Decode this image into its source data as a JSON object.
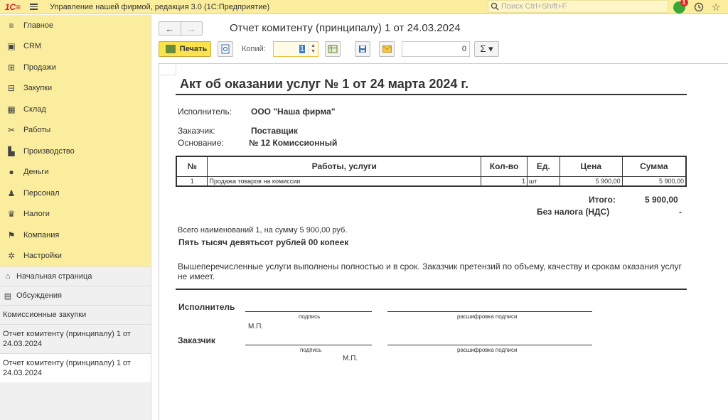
{
  "topbar": {
    "logo": "1С",
    "title": "Управление нашей фирмой, редакция 3.0  (1С:Предприятие)",
    "search_placeholder": "Поиск Ctrl+Shift+F",
    "notifications_count": "1"
  },
  "sidebar": {
    "sections": [
      {
        "label": "Главное",
        "icon": "menu-list-icon",
        "glyph": "≡"
      },
      {
        "label": "CRM",
        "icon": "crm-card-icon",
        "glyph": "▣"
      },
      {
        "label": "Продажи",
        "icon": "sales-basket-icon",
        "glyph": "⊞"
      },
      {
        "label": "Закупки",
        "icon": "purchases-icon",
        "glyph": "⊟"
      },
      {
        "label": "Склад",
        "icon": "warehouse-icon",
        "glyph": "▦"
      },
      {
        "label": "Работы",
        "icon": "tools-icon",
        "glyph": "✂"
      },
      {
        "label": "Производство",
        "icon": "factory-icon",
        "glyph": "▙"
      },
      {
        "label": "Деньги",
        "icon": "money-icon",
        "glyph": "●"
      },
      {
        "label": "Персонал",
        "icon": "staff-icon",
        "glyph": "♟"
      },
      {
        "label": "Налоги",
        "icon": "taxes-icon",
        "glyph": "♛"
      },
      {
        "label": "Компания",
        "icon": "company-flag-icon",
        "glyph": "⚑"
      },
      {
        "label": "Настройки",
        "icon": "settings-gear-icon",
        "glyph": "✲"
      }
    ],
    "nav": [
      {
        "label": "Начальная страница",
        "icon": "home-icon",
        "glyph": "⌂"
      },
      {
        "label": "Обсуждения",
        "icon": "discussion-icon",
        "glyph": "▤"
      }
    ],
    "open_windows": [
      "Комиссионные закупки",
      "Отчет комитенту (принципалу) 1 от 24.03.2024",
      "Отчет комитенту (принципалу) 1 от 24.03.2024"
    ]
  },
  "form": {
    "title": "Отчет комитенту (принципалу) 1 от 24.03.2024",
    "print_label": "Печать",
    "copies_label": "Копий:",
    "copies_value": "1",
    "sum_value": "0",
    "sigma": "Σ ▾"
  },
  "document": {
    "title": "Акт об оказании услуг № 1 от 24 марта 2024 г.",
    "executor_label": "Исполнитель:",
    "executor_value": "ООО \"Наша фирма\"",
    "customer_label": "Заказчик:",
    "customer_value": "Поставщик",
    "basis_label": "Основание:",
    "basis_value": "№ 12 Комиссионный",
    "table": {
      "headers": [
        "№",
        "Работы, услуги",
        "Кол-во",
        "Ед.",
        "Цена",
        "Сумма"
      ],
      "rows": [
        [
          "1",
          "Продажа товаров на комиссии",
          "1",
          "шт",
          "5 900,00",
          "5 900,00"
        ]
      ]
    },
    "total_label": "Итого:",
    "total_value": "5 900,00",
    "vat_label": "Без налога (НДС)",
    "vat_value": "-",
    "summary_line": "Всего наименований 1, на сумму 5 900,00 руб.",
    "amount_words": "Пять тысяч девятьсот рублей 00 копеек",
    "statement": "Вышеперечисленные услуги выполнены полностью и в срок. Заказчик претензий по объему, качеству и срокам оказания услуг не имеет.",
    "sign_executor": "Исполнитель",
    "sign_customer": "Заказчик",
    "caption_signature": "подпись",
    "caption_decoding": "расшифровка подписи",
    "stamp": "М.П."
  },
  "colors": {
    "accent_yellow": "#fbed9e",
    "print_button": "#fbe34d",
    "notification_green": "#3aa635",
    "badge_red": "#e32a2a"
  }
}
